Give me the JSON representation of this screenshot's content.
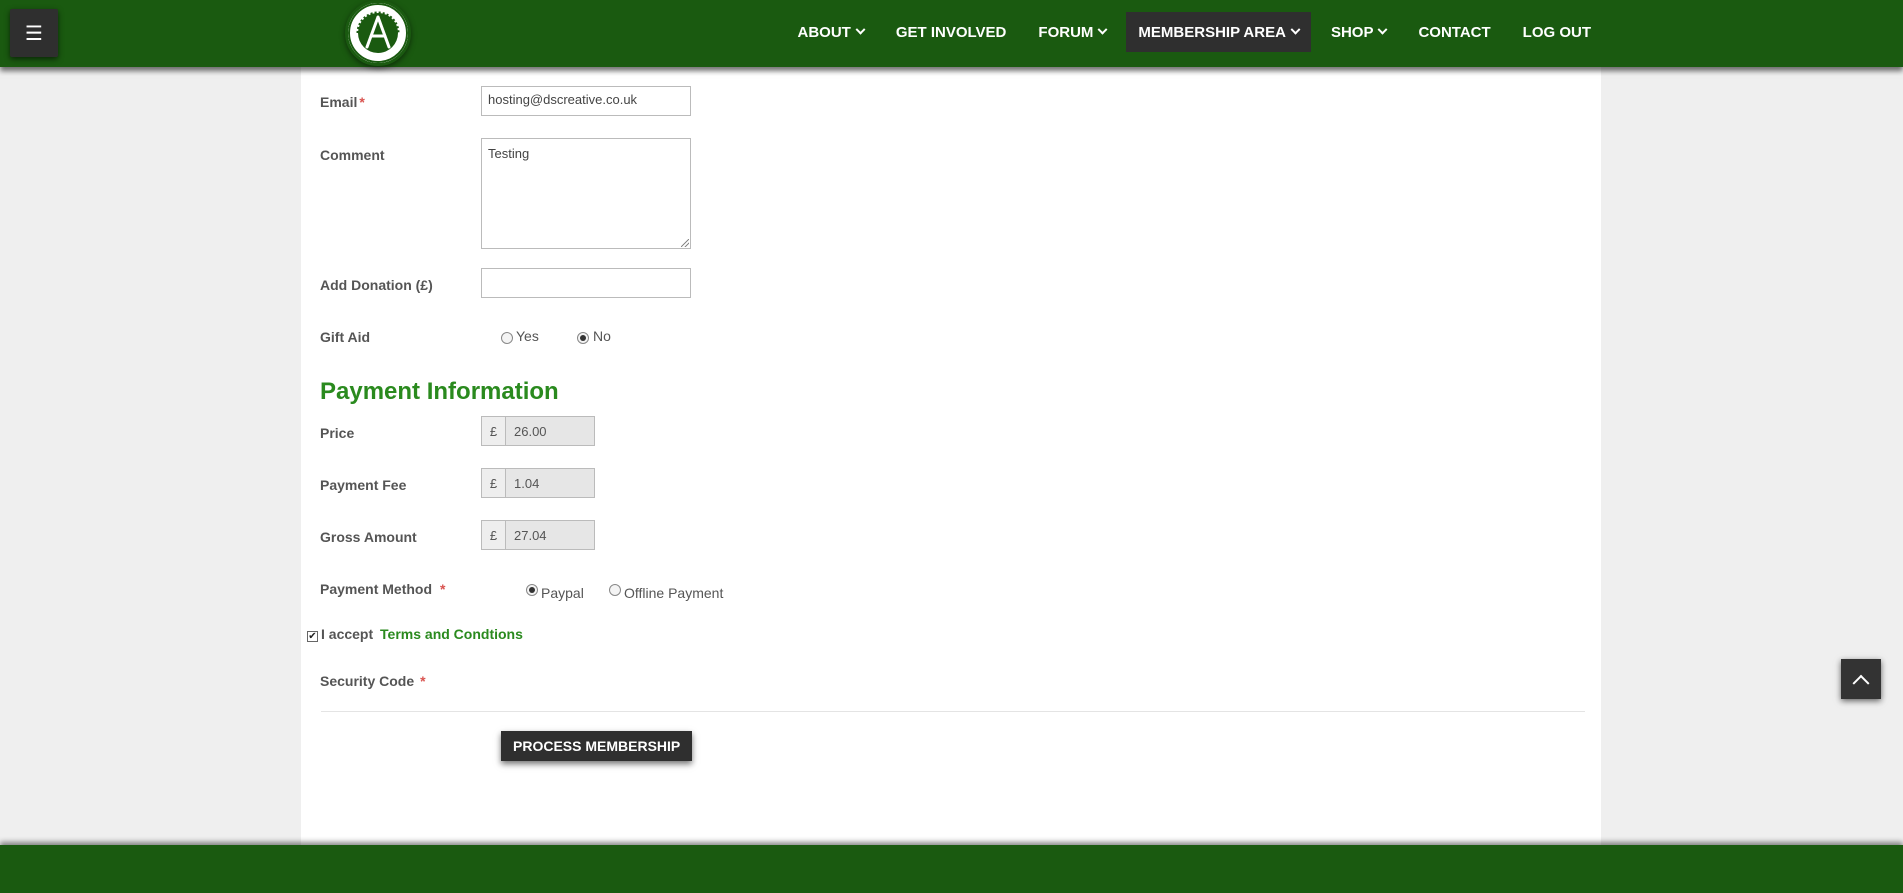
{
  "header": {
    "menu_icon": "☰",
    "logo_alt": "club-logo",
    "nav": [
      {
        "label": "ABOUT",
        "dropdown": true
      },
      {
        "label": "GET INVOLVED",
        "dropdown": false
      },
      {
        "label": "FORUM",
        "dropdown": true
      },
      {
        "label": "MEMBERSHIP AREA",
        "dropdown": true,
        "active": true
      },
      {
        "label": "SHOP",
        "dropdown": true
      },
      {
        "label": "CONTACT",
        "dropdown": false
      },
      {
        "label": "LOG OUT",
        "dropdown": false
      }
    ]
  },
  "form": {
    "email": {
      "label": "Email",
      "required": "*",
      "value": "hosting@dscreative.co.uk"
    },
    "comment": {
      "label": "Comment",
      "value": "Testing"
    },
    "donation": {
      "label": "Add Donation (£)",
      "value": ""
    },
    "gift_aid": {
      "label": "Gift Aid",
      "options": [
        "Yes",
        "No"
      ],
      "selected": "No"
    }
  },
  "payment": {
    "title": "Payment Information",
    "currency": "£",
    "price": {
      "label": "Price",
      "value": "26.00"
    },
    "fee": {
      "label": "Payment Fee",
      "value": "1.04"
    },
    "gross": {
      "label": "Gross Amount",
      "value": "27.04"
    },
    "method": {
      "label": "Payment Method",
      "required": "*",
      "options": [
        "Paypal",
        "Offline Payment"
      ],
      "selected": "Paypal"
    },
    "terms": {
      "prefix": "I accept",
      "link": "Terms and Condtions",
      "checked": "✔"
    },
    "security": {
      "label": "Security Code",
      "required": "*"
    },
    "submit": "PROCESS MEMBERSHIP"
  },
  "colors": {
    "brand_green": "#1a5a10",
    "accent_green": "#2a8a1e",
    "dark": "#2f2f2f"
  }
}
